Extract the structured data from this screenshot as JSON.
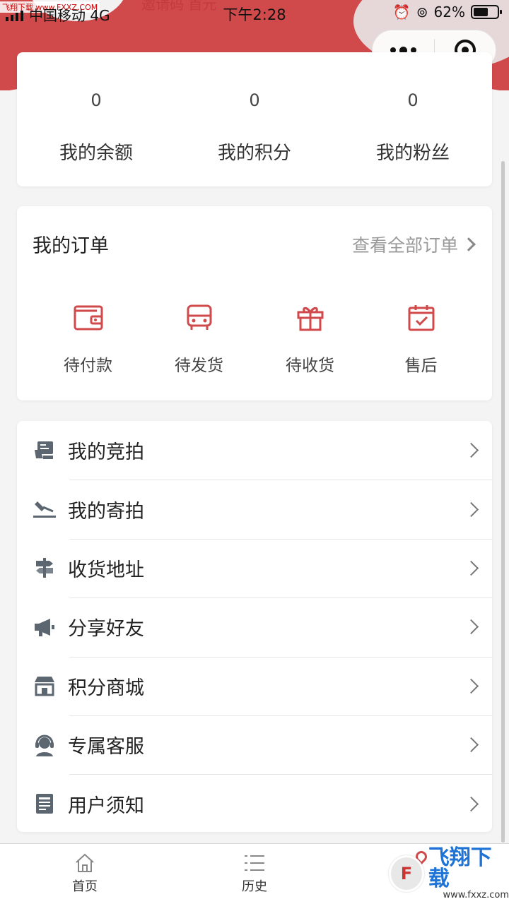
{
  "status_bar": {
    "watermark_text": "飞翔下载 www.FXXZ.COM",
    "carrier": "中国移动 4G",
    "ghost_text": "邀请码   首元",
    "time": "下午2:28",
    "battery": "62%",
    "battery_level": 0.62
  },
  "stats": [
    {
      "value": "0",
      "label": "我的余额"
    },
    {
      "value": "0",
      "label": "我的积分"
    },
    {
      "value": "0",
      "label": "我的粉丝"
    }
  ],
  "orders": {
    "title": "我的订单",
    "view_all": "查看全部订单",
    "items": [
      {
        "label": "待付款",
        "icon": "wallet-icon"
      },
      {
        "label": "待发货",
        "icon": "truck-icon"
      },
      {
        "label": "待收货",
        "icon": "gift-icon"
      },
      {
        "label": "售后",
        "icon": "calendar-check-icon"
      }
    ]
  },
  "menu": [
    {
      "label": "我的竞拍",
      "icon": "auction-screen-icon"
    },
    {
      "label": "我的寄拍",
      "icon": "gavel-icon"
    },
    {
      "label": "收货地址",
      "icon": "signpost-icon"
    },
    {
      "label": "分享好友",
      "icon": "megaphone-icon"
    },
    {
      "label": "积分商城",
      "icon": "store-icon"
    },
    {
      "label": "专属客服",
      "icon": "headset-agent-icon"
    },
    {
      "label": "用户须知",
      "icon": "document-icon"
    }
  ],
  "tabbar": [
    {
      "label": "首页",
      "icon": "home-icon"
    },
    {
      "label": "历史",
      "icon": "list-icon"
    },
    {
      "label": "",
      "icon": "location-pin-icon"
    }
  ],
  "watermark": {
    "brand": "飞翔下载",
    "url": "www.fxxz.com"
  },
  "colors": {
    "accent": "#d0494b",
    "icon_gray": "#5b6670"
  }
}
